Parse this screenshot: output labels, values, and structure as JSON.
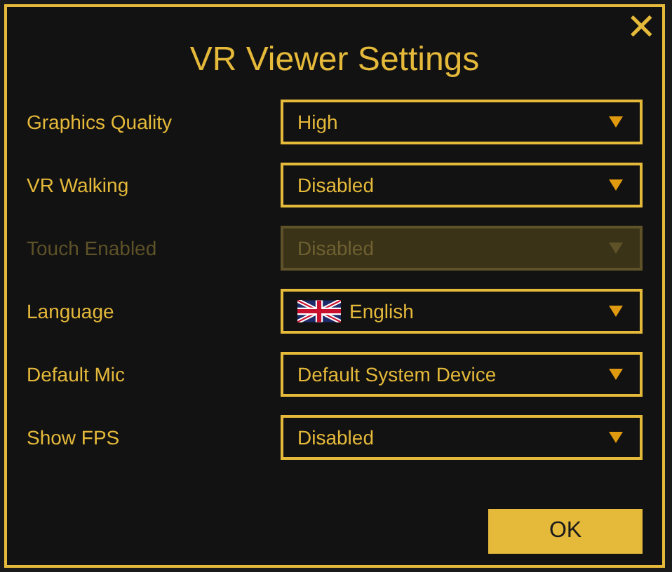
{
  "dialog": {
    "title": "VR Viewer Settings",
    "close": "✕",
    "settings": [
      {
        "label": "Graphics Quality",
        "value": "High",
        "kind": "select",
        "disabled": false
      },
      {
        "label": "VR Walking",
        "value": "Disabled",
        "kind": "select",
        "disabled": false
      },
      {
        "label": "Touch Enabled",
        "value": "Disabled",
        "kind": "select",
        "disabled": true
      },
      {
        "label": "Language",
        "value": "English",
        "kind": "flag-select",
        "disabled": false
      },
      {
        "label": "Default Mic",
        "value": "Default System Device",
        "kind": "select",
        "disabled": false
      },
      {
        "label": "Show FPS",
        "value": "Disabled",
        "kind": "select",
        "disabled": false
      }
    ],
    "ok_button": "OK"
  }
}
